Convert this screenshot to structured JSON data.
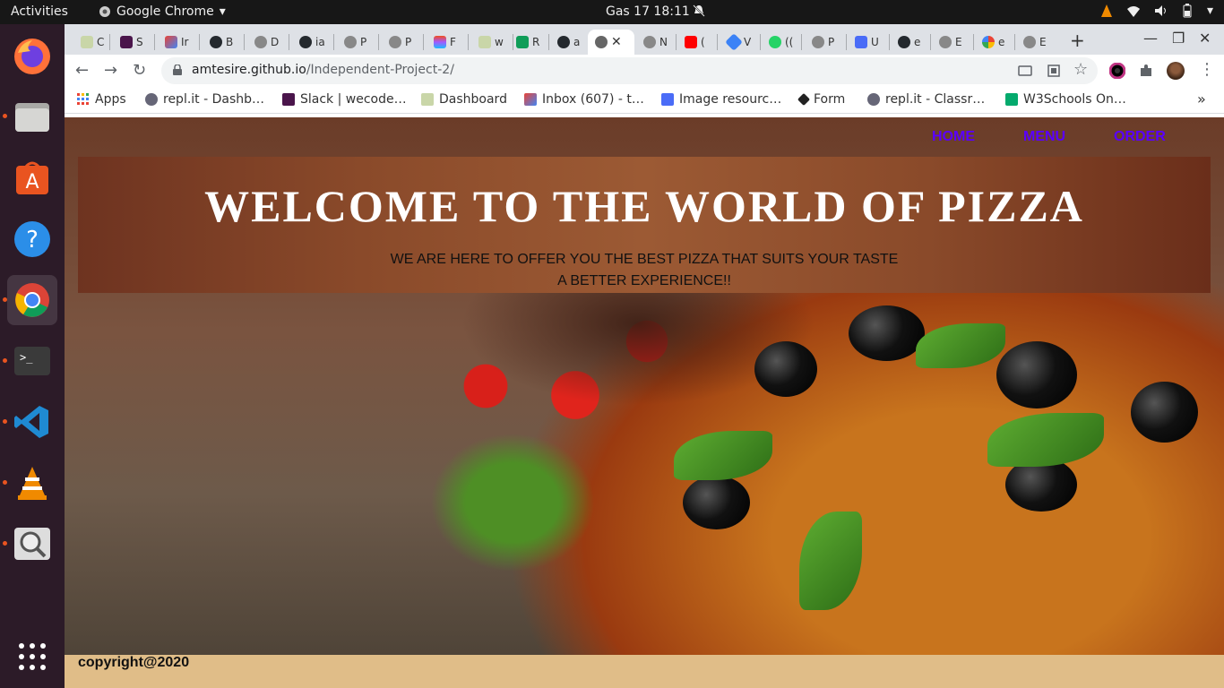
{
  "system": {
    "activities": "Activities",
    "app_name": "Google Chrome",
    "clock": "Gas 17  18:11"
  },
  "dock": {
    "items": [
      "firefox-icon",
      "files-icon",
      "software-icon",
      "help-icon",
      "chrome-icon",
      "terminal-icon",
      "vscode-icon",
      "vlc-icon",
      "search-tool-icon",
      "show-apps-icon"
    ]
  },
  "browser": {
    "tabs": [
      {
        "label": "C"
      },
      {
        "label": "S"
      },
      {
        "label": "Ir"
      },
      {
        "label": "B"
      },
      {
        "label": "D"
      },
      {
        "label": "ia"
      },
      {
        "label": "P"
      },
      {
        "label": "P"
      },
      {
        "label": "F"
      },
      {
        "label": "w"
      },
      {
        "label": "R"
      },
      {
        "label": "a"
      },
      {
        "label": ""
      },
      {
        "label": "N"
      },
      {
        "label": "("
      },
      {
        "label": "V"
      },
      {
        "label": "(("
      },
      {
        "label": "P"
      },
      {
        "label": "U"
      },
      {
        "label": "e"
      },
      {
        "label": "E"
      },
      {
        "label": "e"
      },
      {
        "label": "E"
      }
    ],
    "url_host": "amtesire.github.io",
    "url_path": "/Independent-Project-2/",
    "bookmarks": [
      "Apps",
      "repl.it - Dashb…",
      "Slack | wecode…",
      "Dashboard",
      "Inbox (607) - t…",
      "Image resourc…",
      "Form",
      "repl.it - Classr…",
      "W3Schools On…"
    ],
    "more_bookmarks": "»"
  },
  "page": {
    "nav": {
      "home": "HOME",
      "menu": "MENU",
      "order": "ORDER"
    },
    "title": "WELCOME TO THE WORLD OF PIZZA",
    "subtitle_line1": "WE ARE HERE TO OFFER YOU THE BEST PIZZA THAT SUITS YOUR TASTE",
    "subtitle_line2": "A BETTER EXPERIENCE!!",
    "footer": "copyright@2020"
  },
  "colors": {
    "nav_link": "#5a00ff",
    "footer_bg": "#e0bd88",
    "dock_bg": "#2c1b28",
    "ubuntu_orange": "#e95420"
  }
}
